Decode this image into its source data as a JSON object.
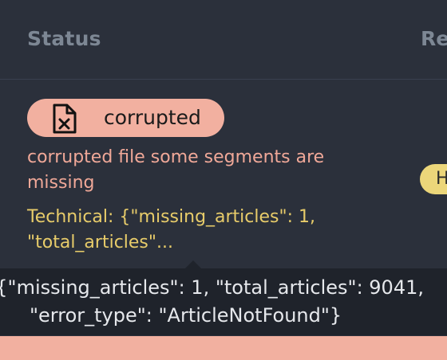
{
  "table": {
    "header": {
      "status_label": "Status",
      "next_column_label": "Re"
    }
  },
  "row": {
    "status_badge": {
      "label": "corrupted",
      "icon": "corrupted-file-icon",
      "color": "#f2b0a0"
    },
    "error_message": "corrupted file some segments are missing",
    "technical_preview": "Technical: {\"missing_articles\": 1, \"total_articles\"...",
    "right_pill_label": "H"
  },
  "tooltip": {
    "line1": "{\"missing_articles\": 1, \"total_articles\": 9041,",
    "line2": "\"error_type\": \"ArticleNotFound\"}"
  },
  "colors": {
    "background": "#2b303b",
    "header_text": "#7d8794",
    "error_text": "#f0a898",
    "technical_text": "#e8cc6a",
    "tooltip_bg": "#1f232b",
    "tooltip_text": "#e6e8ec"
  }
}
